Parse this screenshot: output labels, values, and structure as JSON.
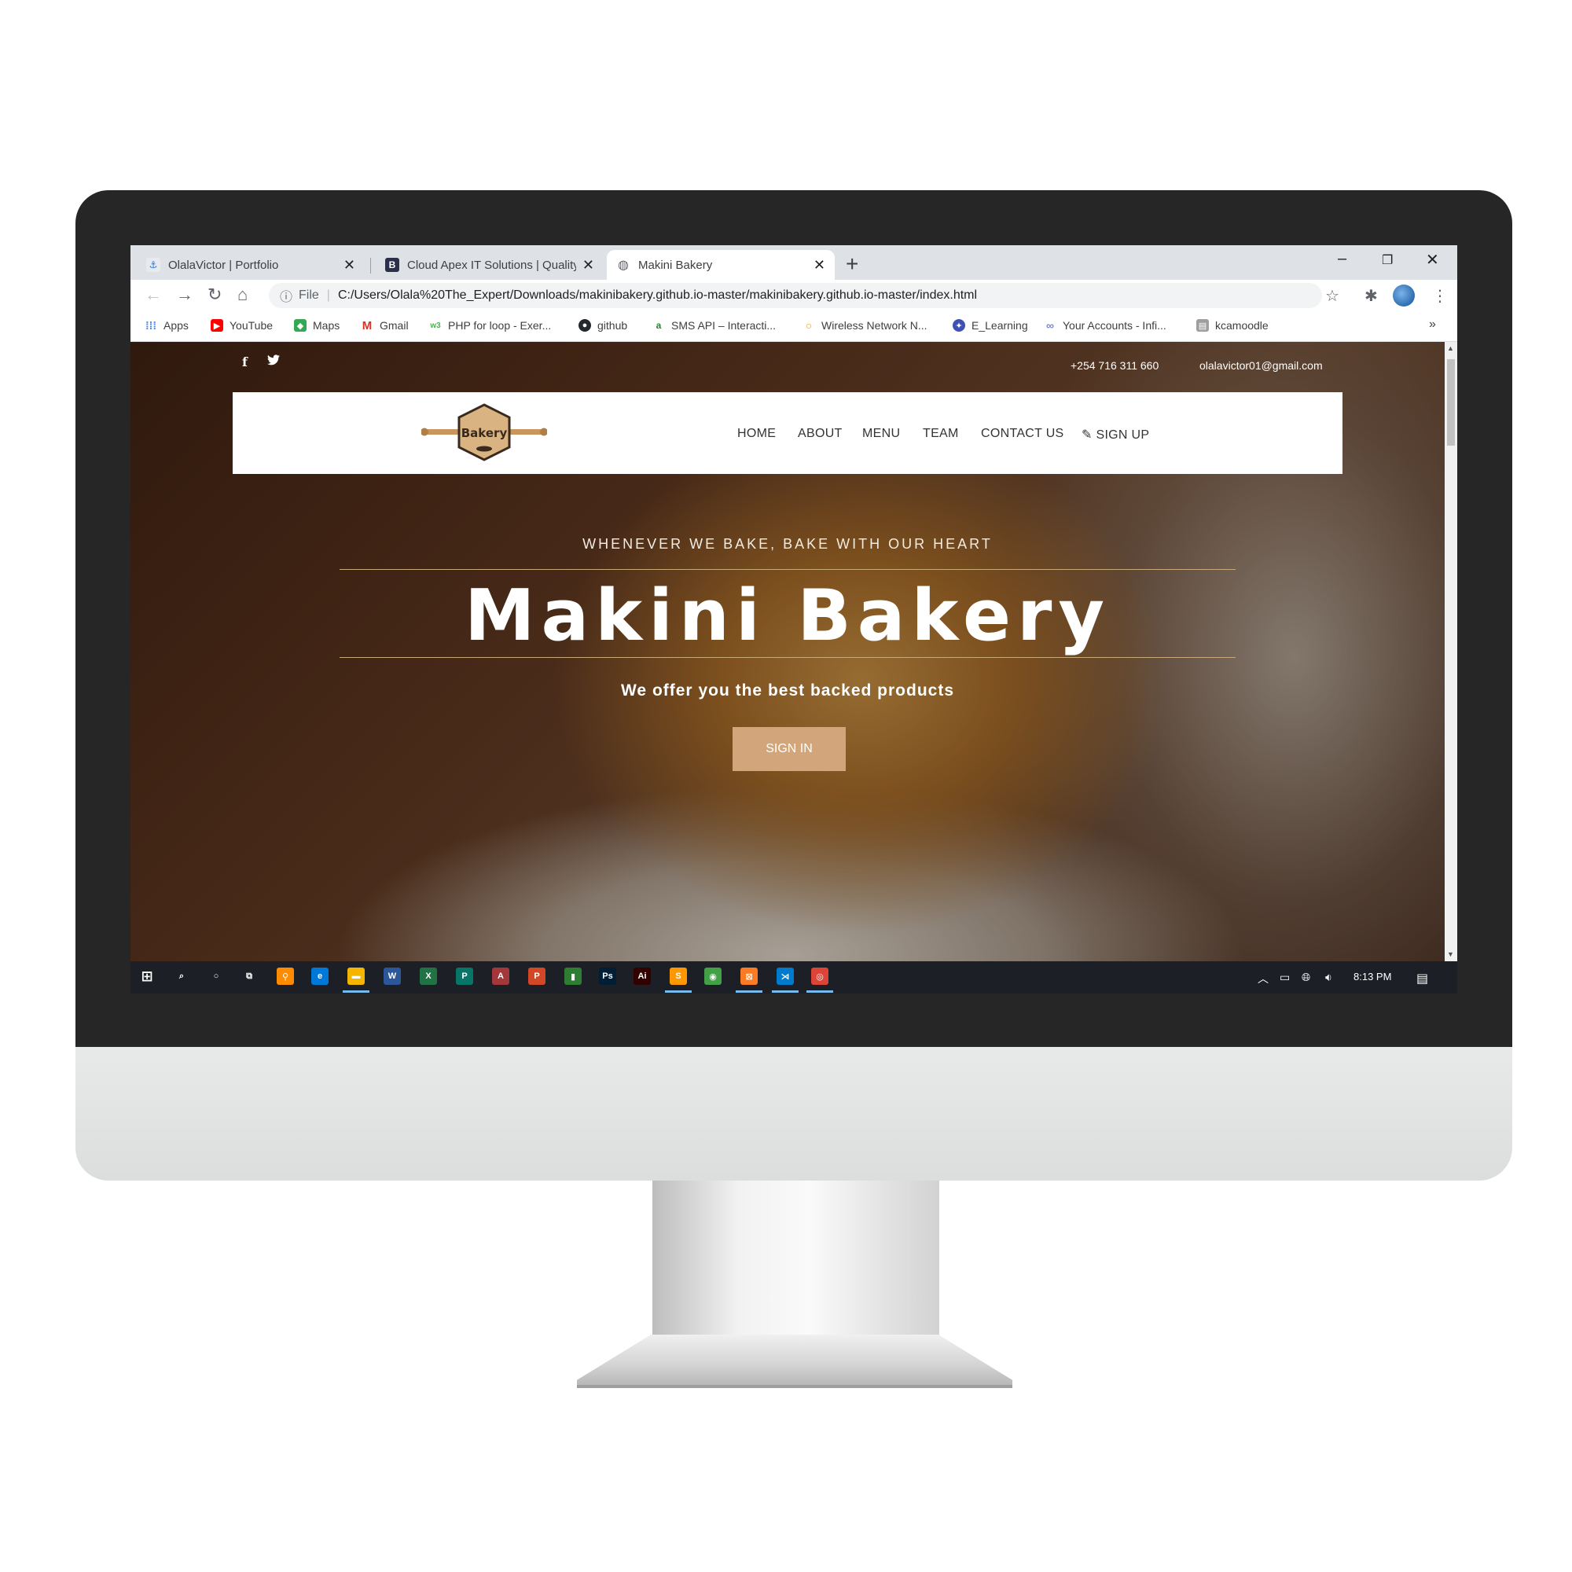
{
  "browser": {
    "tabs": [
      {
        "title": "OlalaVictor | Portfolio",
        "active": false
      },
      {
        "title": "Cloud Apex IT Solutions | Quality",
        "active": false
      },
      {
        "title": "Makini Bakery",
        "active": true
      }
    ],
    "new_tab": "+",
    "window_controls": {
      "minimize": "–",
      "restore": "❐",
      "close": "✕"
    },
    "address": {
      "info_icon": "ⓘ",
      "scheme_label": "File",
      "url": "C:/Users/Olala%20The_Expert/Downloads/makinibakery.github.io-master/makinibakery.github.io-master/index.html"
    },
    "bookmarks": [
      {
        "label": "Apps",
        "icon": "apps-icon",
        "color": "#4285f4"
      },
      {
        "label": "YouTube",
        "icon": "youtube-icon",
        "color": "#ff0000"
      },
      {
        "label": "Maps",
        "icon": "maps-icon",
        "color": "#34a853"
      },
      {
        "label": "Gmail",
        "icon": "gmail-icon",
        "color": "#d93025"
      },
      {
        "label": "PHP for loop - Exer...",
        "icon": "w3-icon",
        "color": "#4caf50"
      },
      {
        "label": "github",
        "icon": "github-icon",
        "color": "#24292e"
      },
      {
        "label": "SMS API – Interacti...",
        "icon": "sms-icon",
        "color": "#2e7d32"
      },
      {
        "label": "Wireless Network N...",
        "icon": "wireless-icon",
        "color": "#ff9800"
      },
      {
        "label": "E_Learning",
        "icon": "elearning-icon",
        "color": "#3f51b5"
      },
      {
        "label": "Your Accounts - Infi...",
        "icon": "infinity-icon",
        "color": "#7986cb"
      },
      {
        "label": "kcamoodle",
        "icon": "moodle-icon",
        "color": "#9e9e9e"
      }
    ],
    "bookmarks_overflow": "»"
  },
  "page": {
    "topbar": {
      "facebook": "f",
      "twitter": "🐦",
      "phone": "+254 716 311 660",
      "email": "olalavictor01@gmail.com"
    },
    "logo_text": "Bakery",
    "nav": [
      {
        "label": "HOME"
      },
      {
        "label": "ABOUT"
      },
      {
        "label": "MENU"
      },
      {
        "label": "TEAM"
      },
      {
        "label": "CONTACT US"
      },
      {
        "label": "SIGN UP",
        "icon": "edit-icon"
      }
    ],
    "hero": {
      "tagline": "WHENEVER WE BAKE, BAKE WITH OUR HEART",
      "title": "Makini Bakery",
      "subtitle": "We offer you the best backed products",
      "button": "SIGN IN"
    },
    "colors": {
      "accent": "#d2a57b",
      "rule": "#c8a978"
    }
  },
  "taskbar": {
    "time": "8:13 PM",
    "apps": [
      {
        "name": "search-taskbar-icon",
        "glyph": "⌕",
        "color": "#1c1f26"
      },
      {
        "name": "cortana-icon",
        "glyph": "○",
        "color": "#1c1f26"
      },
      {
        "name": "task-view-icon",
        "glyph": "⧉",
        "color": "#1c1f26"
      },
      {
        "name": "search-app-icon",
        "glyph": "⚲",
        "color": "#ff8c00"
      },
      {
        "name": "edge-icon",
        "glyph": "e",
        "color": "#0078d7"
      },
      {
        "name": "file-explorer-icon",
        "glyph": "▬",
        "color": "#f4b400"
      },
      {
        "name": "word-icon",
        "glyph": "W",
        "color": "#2b579a"
      },
      {
        "name": "excel-icon",
        "glyph": "X",
        "color": "#217346"
      },
      {
        "name": "publisher-icon",
        "glyph": "P",
        "color": "#077568"
      },
      {
        "name": "access-icon",
        "glyph": "A",
        "color": "#a4373a"
      },
      {
        "name": "powerpoint-icon",
        "glyph": "P",
        "color": "#d24726"
      },
      {
        "name": "recycle-icon",
        "glyph": "▮",
        "color": "#2e7d32"
      },
      {
        "name": "photoshop-icon",
        "glyph": "Ps",
        "color": "#001e36"
      },
      {
        "name": "illustrator-icon",
        "glyph": "Ai",
        "color": "#330000"
      },
      {
        "name": "sublime-icon",
        "glyph": "S",
        "color": "#ff9800"
      },
      {
        "name": "app-green-icon",
        "glyph": "◉",
        "color": "#43a047"
      },
      {
        "name": "xampp-icon",
        "glyph": "⊠",
        "color": "#fb7a24"
      },
      {
        "name": "vscode-icon",
        "glyph": "⋊",
        "color": "#007acc"
      },
      {
        "name": "chrome-icon",
        "glyph": "◎",
        "color": "#db4437"
      }
    ]
  }
}
